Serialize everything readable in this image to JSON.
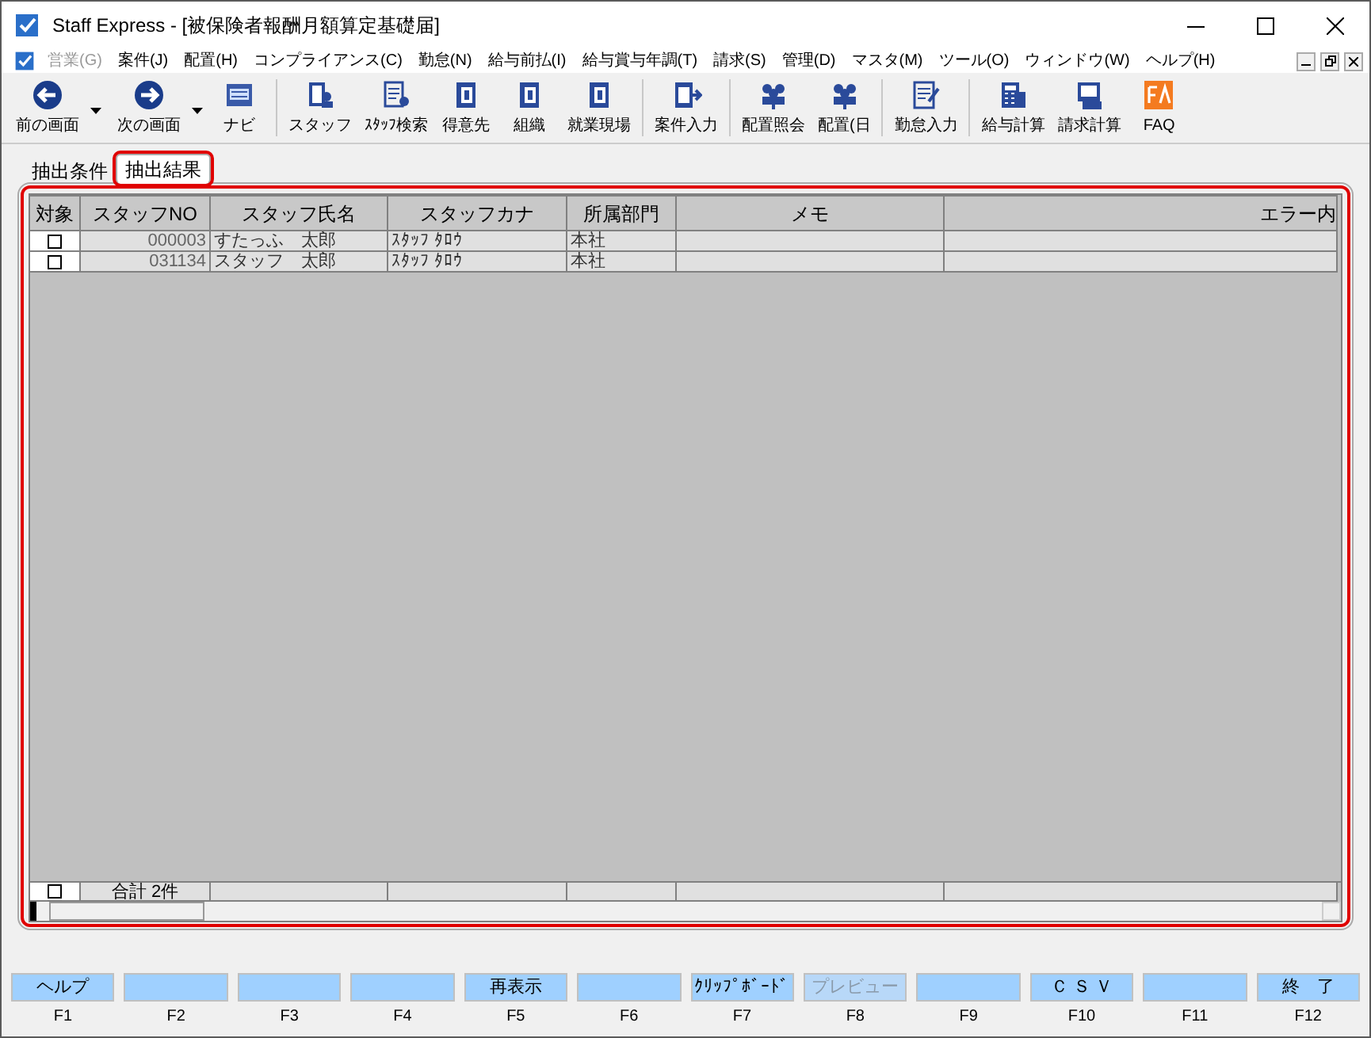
{
  "window": {
    "title": "Staff Express - [被保険者報酬月額算定基礎届]"
  },
  "menu": [
    {
      "label": "営業(G)",
      "disabled": true
    },
    {
      "label": "案件(J)",
      "disabled": false
    },
    {
      "label": "配置(H)",
      "disabled": false
    },
    {
      "label": "コンプライアンス(C)",
      "disabled": false
    },
    {
      "label": "勤怠(N)",
      "disabled": false
    },
    {
      "label": "給与前払(I)",
      "disabled": false
    },
    {
      "label": "給与賞与年調(T)",
      "disabled": false
    },
    {
      "label": "請求(S)",
      "disabled": false
    },
    {
      "label": "管理(D)",
      "disabled": false
    },
    {
      "label": "マスタ(M)",
      "disabled": false
    },
    {
      "label": "ツール(O)",
      "disabled": false
    },
    {
      "label": "ウィンドウ(W)",
      "disabled": false
    },
    {
      "label": "ヘルプ(H)",
      "disabled": false
    }
  ],
  "toolbar": [
    {
      "label": "前の画面",
      "dropdown": true,
      "separator_before": false
    },
    {
      "label": "次の画面",
      "dropdown": true,
      "separator_before": false
    },
    {
      "label": "ナビ",
      "dropdown": false,
      "separator_before": false
    },
    {
      "label": "スタッフ",
      "dropdown": false,
      "separator_before": true
    },
    {
      "label": "ｽﾀｯﾌ検索",
      "dropdown": false,
      "separator_before": false
    },
    {
      "label": "得意先",
      "dropdown": false,
      "separator_before": false
    },
    {
      "label": "組織",
      "dropdown": false,
      "separator_before": false
    },
    {
      "label": "就業現場",
      "dropdown": false,
      "separator_before": false
    },
    {
      "label": "案件入力",
      "dropdown": false,
      "separator_before": true
    },
    {
      "label": "配置照会",
      "dropdown": false,
      "separator_before": true
    },
    {
      "label": "配置(日",
      "dropdown": false,
      "separator_before": false
    },
    {
      "label": "勤怠入力",
      "dropdown": false,
      "separator_before": true
    },
    {
      "label": "給与計算",
      "dropdown": false,
      "separator_before": true
    },
    {
      "label": "請求計算",
      "dropdown": false,
      "separator_before": false
    },
    {
      "label": "FAQ",
      "dropdown": false,
      "separator_before": false
    }
  ],
  "tabs": [
    {
      "label": "抽出条件",
      "selected": false,
      "highlighted": false
    },
    {
      "label": "抽出結果",
      "selected": true,
      "highlighted": true
    }
  ],
  "results": {
    "highlighted": true,
    "columns": [
      "対象",
      "スタッフNO",
      "スタッフ氏名",
      "スタッフカナ",
      "所属部門",
      "メモ",
      "エラー内"
    ],
    "rows": [
      {
        "checked": false,
        "cells": [
          "",
          "000003",
          "すたっふ　太郎",
          "ｽﾀｯﾌ ﾀﾛｳ",
          "本社",
          "",
          ""
        ]
      },
      {
        "checked": false,
        "cells": [
          "",
          "031134",
          "スタッフ　太郎",
          "ｽﾀｯﾌ ﾀﾛｳ",
          "本社",
          "",
          ""
        ]
      }
    ],
    "footer": {
      "checked": false,
      "total": "合計 2件"
    }
  },
  "function_keys": [
    {
      "label": "ヘルプ",
      "key": "F1",
      "disabled": false
    },
    {
      "key": "F2",
      "disabled": false
    },
    {
      "key": "F3",
      "disabled": false
    },
    {
      "key": "F4",
      "disabled": false
    },
    {
      "label": "再表示",
      "key": "F5",
      "disabled": false
    },
    {
      "key": "F6",
      "disabled": false
    },
    {
      "label": "ｸﾘｯﾌﾟﾎﾞｰﾄﾞ",
      "key": "F7",
      "disabled": false
    },
    {
      "label": "プレビュー",
      "key": "F8",
      "disabled": true
    },
    {
      "key": "F9",
      "disabled": false
    },
    {
      "label": "Ｃ Ｓ Ｖ",
      "key": "F10",
      "disabled": false
    },
    {
      "key": "F11",
      "disabled": false
    },
    {
      "label": "終　了",
      "key": "F12",
      "disabled": false
    }
  ]
}
